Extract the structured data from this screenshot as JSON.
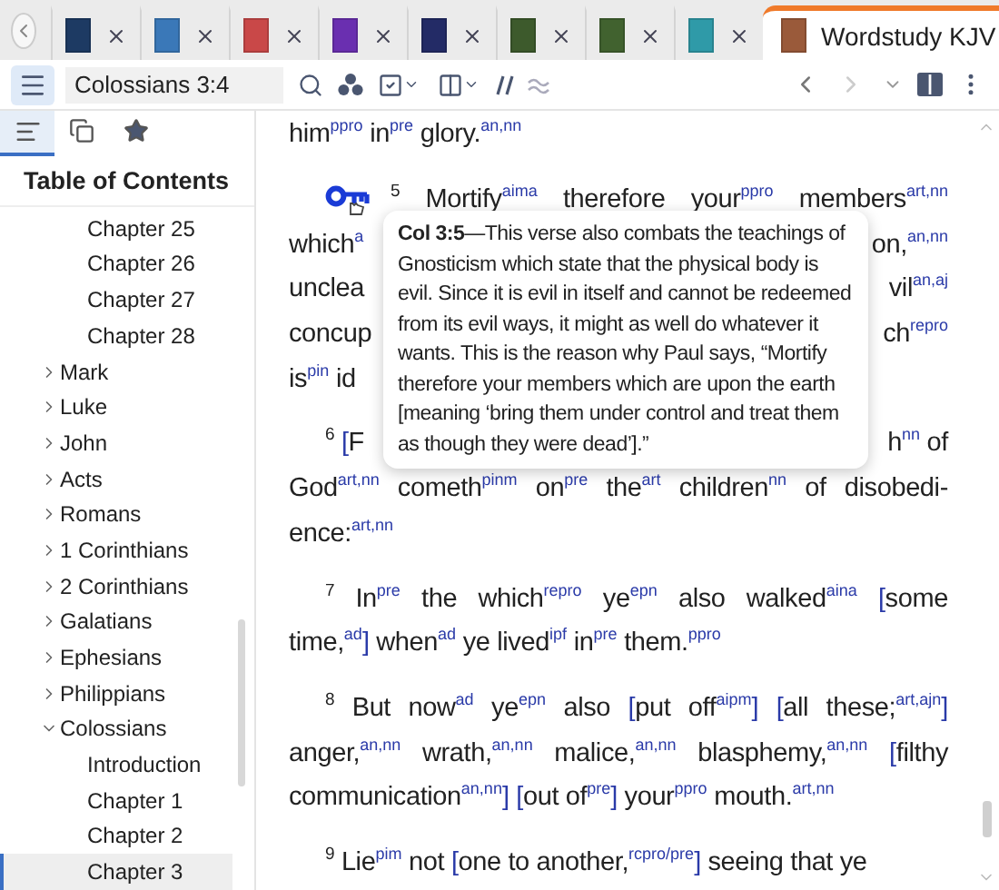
{
  "tabs": [
    {
      "color": "#1d3a63",
      "selected": false
    },
    {
      "color": "#3a78b8",
      "selected": false
    },
    {
      "color": "#c94848",
      "selected": false
    },
    {
      "color": "#6a2fb0",
      "selected": false
    },
    {
      "color": "#232b66",
      "selected": false
    },
    {
      "color": "#3d5a2c",
      "selected": false
    },
    {
      "color": "#41622f",
      "selected": false
    },
    {
      "color": "#2f9aa8",
      "selected": false
    },
    {
      "color": "#9a5a3a",
      "selected": true,
      "label": "Wordstudy KJV"
    }
  ],
  "toolbar": {
    "reference": "Colossians 3:4"
  },
  "sidebar": {
    "tabs": [
      {
        "kind": "contents",
        "selected": true
      },
      {
        "kind": "copies",
        "selected": false
      },
      {
        "kind": "favorites",
        "selected": false
      }
    ],
    "heading": "Table of Contents",
    "continued_children": [
      {
        "label": "Chapter 25",
        "selected": false
      },
      {
        "label": "Chapter 26",
        "selected": false
      },
      {
        "label": "Chapter 27",
        "selected": false
      },
      {
        "label": "Chapter 28",
        "selected": false
      }
    ],
    "books": [
      {
        "label": "Mark",
        "expanded": false,
        "selected": false
      },
      {
        "label": "Luke",
        "expanded": false,
        "selected": false
      },
      {
        "label": "John",
        "expanded": false,
        "selected": false
      },
      {
        "label": "Acts",
        "expanded": false,
        "selected": false
      },
      {
        "label": "Romans",
        "expanded": false,
        "selected": false
      },
      {
        "label": "1 Corinthians",
        "expanded": false,
        "selected": false
      },
      {
        "label": "2 Corinthians",
        "expanded": false,
        "selected": false
      },
      {
        "label": "Galatians",
        "expanded": false,
        "selected": false
      },
      {
        "label": "Ephesians",
        "expanded": false,
        "selected": false
      },
      {
        "label": "Philippians",
        "expanded": false,
        "selected": false
      },
      {
        "label": "Colossians",
        "expanded": true,
        "selected": false,
        "children": [
          {
            "label": "Introduction",
            "selected": false
          },
          {
            "label": "Chapter 1",
            "selected": false
          },
          {
            "label": "Chapter 2",
            "selected": false
          },
          {
            "label": "Chapter 3",
            "selected": true
          }
        ]
      }
    ]
  },
  "paragraphs": [
    {
      "lines": [
        {
          "tokens": [
            {
              "word": "him",
              "tag": "ppro"
            },
            {
              "word": "in",
              "tag": "pre"
            },
            {
              "word": "glory.",
              "tag": "an,nn"
            }
          ]
        }
      ]
    },
    {
      "lines": [
        {
          "bookmark": true,
          "tokens": [
            {
              "verse": "5"
            },
            {
              "word": "Mortify",
              "tag": "aima"
            },
            {
              "word": "therefore"
            },
            {
              "word": "your",
              "tag": "ppro"
            },
            {
              "word": "members",
              "tag": "art,nn"
            }
          ]
        },
        {
          "left": [
            {
              "word": "which",
              "tag": "a"
            }
          ],
          "right": [
            {
              "word": "on,",
              "tag": "an,nn"
            }
          ]
        },
        {
          "left": [
            {
              "word": "unclea"
            }
          ],
          "right": [
            {
              "word": "vil",
              "tag": "an,aj"
            }
          ]
        },
        {
          "left": [
            {
              "word": "concup"
            }
          ],
          "right": [
            {
              "word": "ch",
              "tag": "repro"
            }
          ]
        },
        {
          "left": [
            {
              "word": "is",
              "tag": "pin"
            },
            {
              "word": "id"
            }
          ]
        }
      ]
    },
    {
      "lines": [
        {
          "left": [
            {
              "verse": "6"
            },
            {
              "word": "F",
              "open": "["
            }
          ],
          "right": [
            {
              "word": "h",
              "tag": "nn"
            },
            {
              "word": "of"
            }
          ]
        },
        {
          "tokens": [
            {
              "word": "God",
              "tag": "art,nn"
            },
            {
              "word": "cometh",
              "tag": "pinm"
            },
            {
              "word": "on",
              "tag": "pre"
            },
            {
              "word": "the",
              "tag": "art"
            },
            {
              "word": "children",
              "tag": "nn"
            },
            {
              "word": "of"
            },
            {
              "word": "disobedi-"
            }
          ]
        },
        {
          "tokens": [
            {
              "word": "ence:",
              "tag": "art,nn"
            }
          ]
        }
      ]
    },
    {
      "lines": [
        {
          "tokens": [
            {
              "verse": "7"
            },
            {
              "word": "In",
              "tag": "pre"
            },
            {
              "word": "the"
            },
            {
              "word": "which",
              "tag": "repro"
            },
            {
              "word": "ye",
              "tag": "epn"
            },
            {
              "word": "also"
            },
            {
              "word": "walked",
              "tag": "aina"
            },
            {
              "word": "some",
              "open": "["
            }
          ]
        },
        {
          "tokens": [
            {
              "word": "time,",
              "tag": "ad",
              "close": "]"
            },
            {
              "word": "when",
              "tag": "ad"
            },
            {
              "word": "ye"
            },
            {
              "word": "lived",
              "tag": "ipf"
            },
            {
              "word": "in",
              "tag": "pre"
            },
            {
              "word": "them.",
              "tag": "ppro"
            }
          ]
        }
      ]
    },
    {
      "lines": [
        {
          "tokens": [
            {
              "verse": "8"
            },
            {
              "word": "But"
            },
            {
              "word": "now",
              "tag": "ad"
            },
            {
              "word": "ye",
              "tag": "epn"
            },
            {
              "word": "also"
            },
            {
              "word": "put off",
              "open": "[",
              "tag": "aipm",
              "close": "]"
            },
            {
              "word": "all these;",
              "open": "[",
              "tag": "art,ajn",
              "close": "]"
            }
          ]
        },
        {
          "tokens": [
            {
              "word": "anger,",
              "tag": "an,nn"
            },
            {
              "word": "wrath,",
              "tag": "an,nn"
            },
            {
              "word": "malice,",
              "tag": "an,nn"
            },
            {
              "word": "blasphemy,",
              "tag": "an,nn"
            },
            {
              "word": "filthy",
              "open": "["
            }
          ]
        },
        {
          "tokens": [
            {
              "word": "communication",
              "tag": "an,nn",
              "close": "]"
            },
            {
              "word": "out of",
              "open": "[",
              "tag": "pre",
              "close": "]"
            },
            {
              "word": "your",
              "tag": "ppro"
            },
            {
              "word": "mouth.",
              "tag": "art,nn"
            }
          ]
        }
      ]
    },
    {
      "lines": [
        {
          "tokens": [
            {
              "verse": "9"
            },
            {
              "word": "Lie",
              "tag": "pim"
            },
            {
              "word": "not"
            },
            {
              "word": "one to another,",
              "open": "[",
              "tag": "rcpro/pre",
              "close": "]"
            },
            {
              "word": "seeing"
            },
            {
              "word": "that"
            },
            {
              "word": "ye"
            }
          ]
        }
      ]
    }
  ],
  "popup": {
    "text": "**Col 3:5**—This verse also combats the teachings of Gnosticism which state that the physical body is evil. Since it is evil in itself and cannot be redeemed from its evil ways, it might as well do whatever it wants. This is the reason why Paul says, “Mortify therefore your members which are upon the earth [meaning ‘bring them under control and treat them as though they were dead’].”"
  }
}
